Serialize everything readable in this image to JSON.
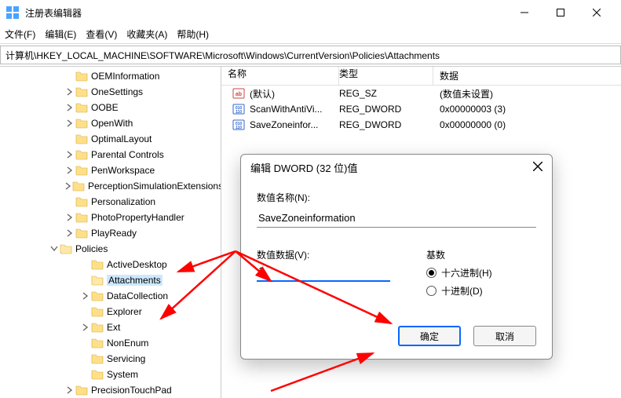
{
  "window": {
    "title": "注册表编辑器"
  },
  "menu": {
    "file": "文件(F)",
    "edit": "编辑(E)",
    "view": "查看(V)",
    "favorites": "收藏夹(A)",
    "help": "帮助(H)"
  },
  "path": "计算机\\HKEY_LOCAL_MACHINE\\SOFTWARE\\Microsoft\\Windows\\CurrentVersion\\Policies\\Attachments",
  "tree": {
    "top_items": [
      "OEMInformation",
      "OneSettings",
      "OOBE",
      "OpenWith",
      "OptimalLayout",
      "Parental Controls",
      "PenWorkspace",
      "PerceptionSimulationExtensions",
      "Personalization",
      "PhotoPropertyHandler",
      "PlayReady"
    ],
    "policies_label": "Policies",
    "policies_children": [
      "ActiveDesktop",
      "Attachments",
      "DataCollection",
      "Explorer",
      "Ext",
      "NonEnum",
      "Servicing",
      "System"
    ],
    "after_item": "PrecisionTouchPad"
  },
  "list": {
    "head_name": "名称",
    "head_type": "类型",
    "head_data": "数据",
    "rows": [
      {
        "icon": "sz",
        "name": "(默认)",
        "type": "REG_SZ",
        "data": "(数值未设置)"
      },
      {
        "icon": "dw",
        "name": "ScanWithAntiVi...",
        "type": "REG_DWORD",
        "data": "0x00000003 (3)"
      },
      {
        "icon": "dw",
        "name": "SaveZoneinfor...",
        "type": "REG_DWORD",
        "data": "0x00000000 (0)"
      }
    ]
  },
  "dialog": {
    "title": "编辑 DWORD (32 位)值",
    "name_label": "数值名称(N):",
    "name_value": "SaveZoneinformation",
    "data_label": "数值数据(V):",
    "data_value": "1",
    "base_label": "基数",
    "radio_hex": "十六进制(H)",
    "radio_dec": "十进制(D)",
    "ok": "确定",
    "cancel": "取消"
  }
}
